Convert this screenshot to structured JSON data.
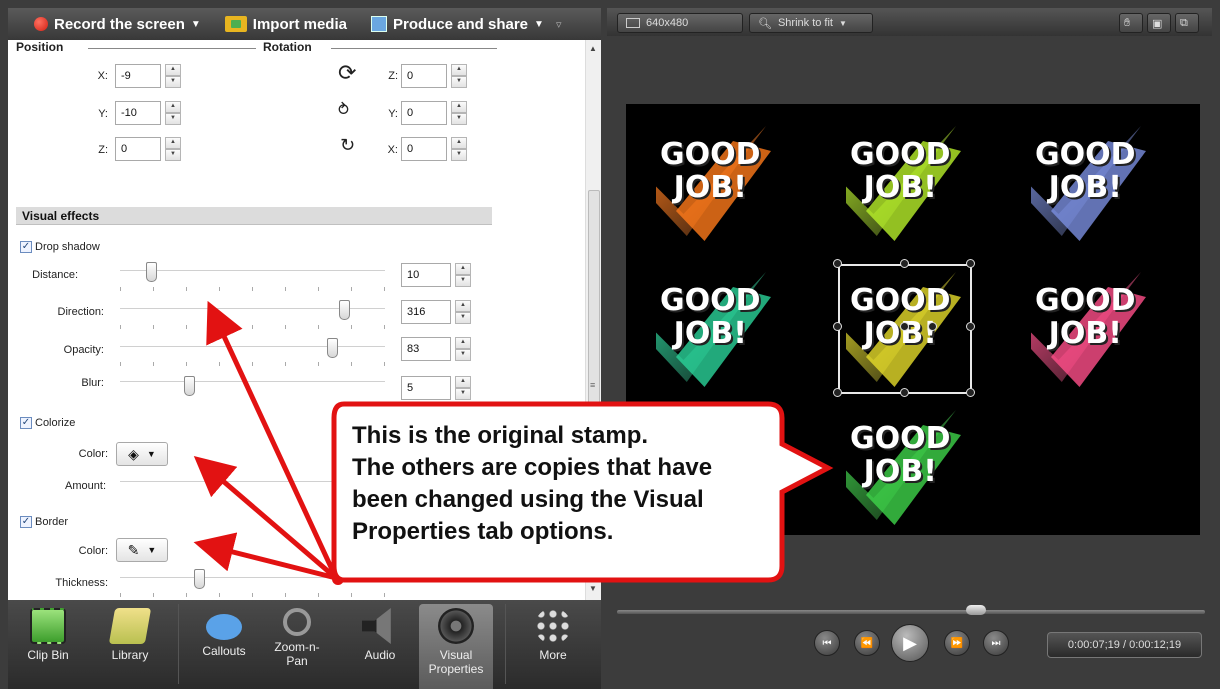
{
  "menubar": {
    "record_label": "Record the screen",
    "import_label": "Import media",
    "produce_label": "Produce and share",
    "extra": "▿"
  },
  "preview_toolbar": {
    "dimensions": "640x480",
    "zoom": "Shrink to fit"
  },
  "properties": {
    "position_header": "Position",
    "rotation_header": "Rotation",
    "position": [
      {
        "axis": "X:",
        "value": "-9"
      },
      {
        "axis": "Y:",
        "value": "-10"
      },
      {
        "axis": "Z:",
        "value": "0"
      }
    ],
    "rotation": [
      {
        "axis": "Z:",
        "value": "0"
      },
      {
        "axis": "Y:",
        "value": "0"
      },
      {
        "axis": "X:",
        "value": "0"
      }
    ],
    "visual_effects_header": "Visual effects",
    "drop_shadow": {
      "label": "Drop shadow",
      "checked": true,
      "distance_label": "Distance:",
      "distance_value": "10",
      "distance_level": 0.12,
      "direction_label": "Direction:",
      "direction_value": "316",
      "direction_level": 0.88,
      "opacity_label": "Opacity:",
      "opacity_value": "83",
      "opacity_level": 0.83,
      "blur_label": "Blur:",
      "blur_value": "5",
      "blur_level": 0.27
    },
    "colorize": {
      "label": "Colorize",
      "checked": true,
      "color_label": "Color:",
      "amount_label": "Amount:"
    },
    "border": {
      "label": "Border",
      "checked": true,
      "color_label": "Color:",
      "thickness_label": "Thickness:",
      "thickness_level": 0.31
    }
  },
  "tabs": [
    {
      "label": "Clip Bin",
      "icon": "film-clip-icon"
    },
    {
      "label": "Library",
      "icon": "library-folder-icon"
    },
    {
      "label": "Callouts",
      "icon": "speech-bubble-icon"
    },
    {
      "label": "Zoom-n-Pan",
      "icon": "magnifier-icon"
    },
    {
      "label": "Audio",
      "icon": "speaker-icon"
    },
    {
      "label": "Visual Properties",
      "icon": "film-reel-icon",
      "selected": true
    },
    {
      "label": "More",
      "icon": "more-dots-icon"
    }
  ],
  "canvas": {
    "stamp_text_1": "GOOD",
    "stamp_text_2": "JOB!",
    "stamp_colors": [
      "#ff7a1a",
      "#b8f02a",
      "#7a8fe0",
      "#2bd39a",
      "#e6dc2a",
      "#ff4f8a",
      "#3fd54a"
    ]
  },
  "callout": {
    "line1": "This is the original stamp.",
    "line2": "The others are copies that have",
    "line3": "been changed using the Visual",
    "line4": "Properties tab options."
  },
  "playback": {
    "timecode": "0:00:07;19 / 0:00:12;19",
    "progress": 0.61
  }
}
